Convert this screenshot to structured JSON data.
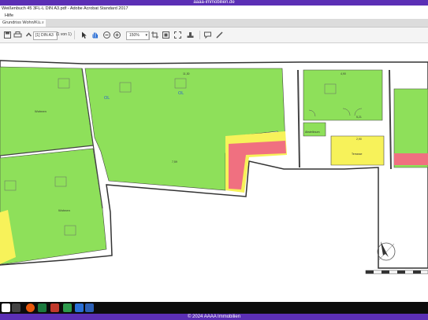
{
  "site_banner": "aaaa-immobilien.de",
  "window_title": "Weißenbuch 45 3FL-L DIN A3.pdf - Adobe Acrobat Standard 2017",
  "menu": {
    "help": "Hilfe"
  },
  "tab": {
    "label": "Grundriss Wohn/Kü...",
    "close": "×"
  },
  "toolbar": {
    "page_field": "[1] DIN A3",
    "page_count": "(1 von 1)",
    "zoom": "150%"
  },
  "plan": {
    "rooms": [
      {
        "label": "Wohnen"
      },
      {
        "label": "OL"
      },
      {
        "label": "OL"
      },
      {
        "label": "Wohnen"
      },
      {
        "label": "Abstellraum"
      },
      {
        "label": "Terrasse"
      }
    ],
    "dimensions": [
      "11,30",
      "7,59",
      "4,90",
      "5,21",
      "2,90"
    ]
  },
  "footer": "© 2024 AAAA Immobilien",
  "colors": {
    "brand": "#5b2fb5",
    "room_fill": "#8ee05a",
    "accent_yellow": "#f7f25a",
    "accent_red": "#f07080"
  }
}
